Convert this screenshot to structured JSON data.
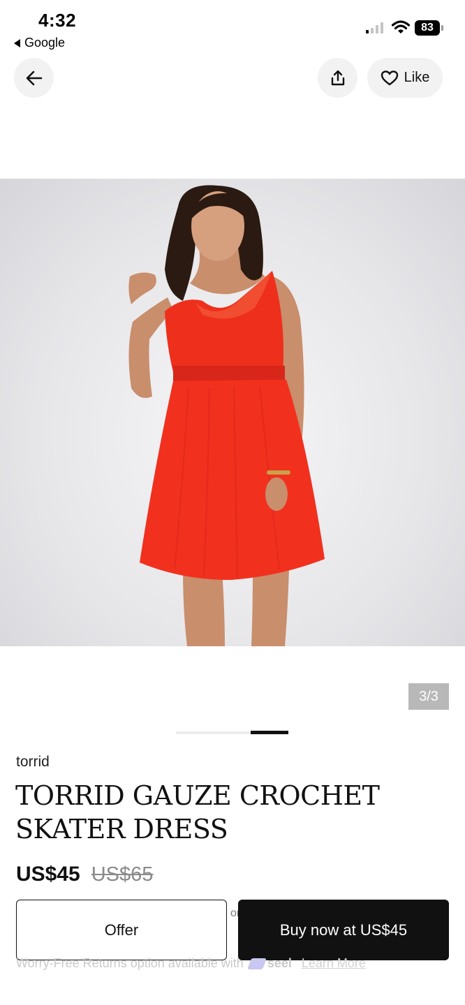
{
  "status_bar": {
    "time": "4:32",
    "back_app": "Google",
    "battery": "83"
  },
  "nav": {
    "like_label": "Like"
  },
  "gallery": {
    "counter": "3/3",
    "dress_color": "#f2301e",
    "progress": 0.333
  },
  "product": {
    "brand": "torrid",
    "title": "TORRID GAUZE CROCHET SKATER DRESS",
    "price": "US$45",
    "original_price": "US$65"
  },
  "actions": {
    "offer_label": "Offer",
    "or_label": "or",
    "buy_label": "Buy now at US$45"
  },
  "returns": {
    "text": "Worry-Free Returns option available with",
    "partner": "seel",
    "learn_more": "Learn More"
  }
}
